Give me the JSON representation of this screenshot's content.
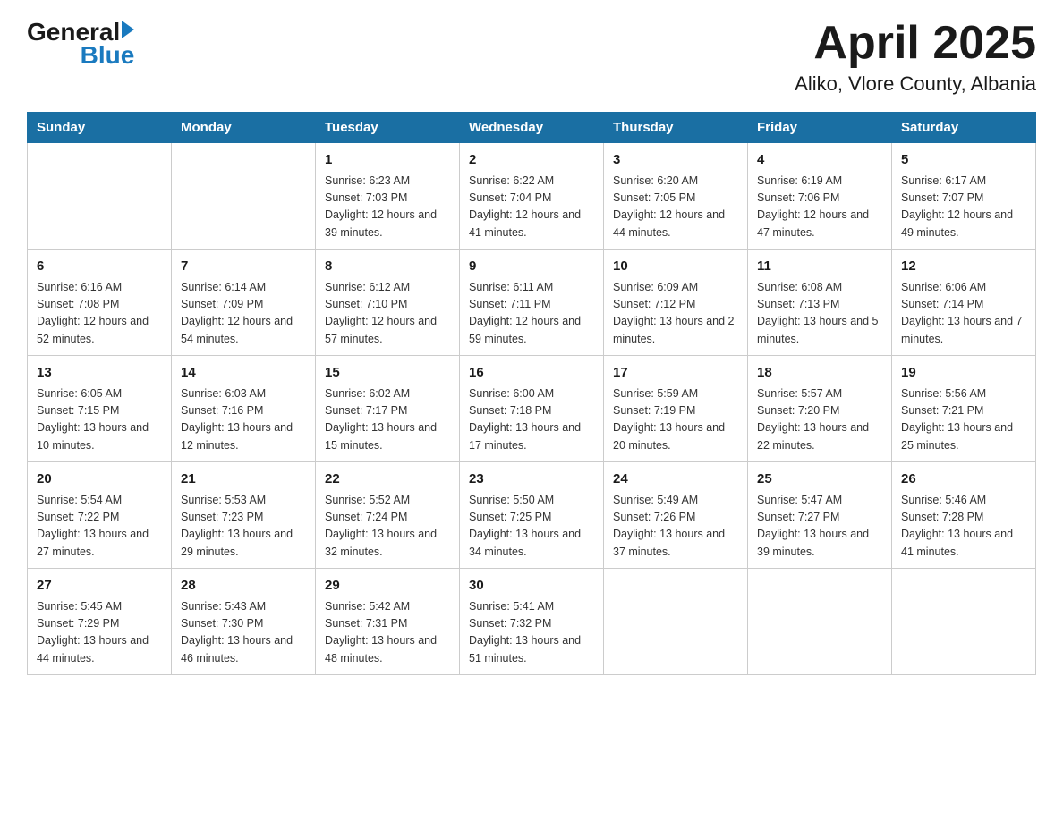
{
  "header": {
    "logo_general": "General",
    "logo_blue": "Blue",
    "month_year": "April 2025",
    "location": "Aliko, Vlore County, Albania"
  },
  "weekdays": [
    "Sunday",
    "Monday",
    "Tuesday",
    "Wednesday",
    "Thursday",
    "Friday",
    "Saturday"
  ],
  "weeks": [
    [
      {
        "day": "",
        "sunrise": "",
        "sunset": "",
        "daylight": ""
      },
      {
        "day": "",
        "sunrise": "",
        "sunset": "",
        "daylight": ""
      },
      {
        "day": "1",
        "sunrise": "Sunrise: 6:23 AM",
        "sunset": "Sunset: 7:03 PM",
        "daylight": "Daylight: 12 hours and 39 minutes."
      },
      {
        "day": "2",
        "sunrise": "Sunrise: 6:22 AM",
        "sunset": "Sunset: 7:04 PM",
        "daylight": "Daylight: 12 hours and 41 minutes."
      },
      {
        "day": "3",
        "sunrise": "Sunrise: 6:20 AM",
        "sunset": "Sunset: 7:05 PM",
        "daylight": "Daylight: 12 hours and 44 minutes."
      },
      {
        "day": "4",
        "sunrise": "Sunrise: 6:19 AM",
        "sunset": "Sunset: 7:06 PM",
        "daylight": "Daylight: 12 hours and 47 minutes."
      },
      {
        "day": "5",
        "sunrise": "Sunrise: 6:17 AM",
        "sunset": "Sunset: 7:07 PM",
        "daylight": "Daylight: 12 hours and 49 minutes."
      }
    ],
    [
      {
        "day": "6",
        "sunrise": "Sunrise: 6:16 AM",
        "sunset": "Sunset: 7:08 PM",
        "daylight": "Daylight: 12 hours and 52 minutes."
      },
      {
        "day": "7",
        "sunrise": "Sunrise: 6:14 AM",
        "sunset": "Sunset: 7:09 PM",
        "daylight": "Daylight: 12 hours and 54 minutes."
      },
      {
        "day": "8",
        "sunrise": "Sunrise: 6:12 AM",
        "sunset": "Sunset: 7:10 PM",
        "daylight": "Daylight: 12 hours and 57 minutes."
      },
      {
        "day": "9",
        "sunrise": "Sunrise: 6:11 AM",
        "sunset": "Sunset: 7:11 PM",
        "daylight": "Daylight: 12 hours and 59 minutes."
      },
      {
        "day": "10",
        "sunrise": "Sunrise: 6:09 AM",
        "sunset": "Sunset: 7:12 PM",
        "daylight": "Daylight: 13 hours and 2 minutes."
      },
      {
        "day": "11",
        "sunrise": "Sunrise: 6:08 AM",
        "sunset": "Sunset: 7:13 PM",
        "daylight": "Daylight: 13 hours and 5 minutes."
      },
      {
        "day": "12",
        "sunrise": "Sunrise: 6:06 AM",
        "sunset": "Sunset: 7:14 PM",
        "daylight": "Daylight: 13 hours and 7 minutes."
      }
    ],
    [
      {
        "day": "13",
        "sunrise": "Sunrise: 6:05 AM",
        "sunset": "Sunset: 7:15 PM",
        "daylight": "Daylight: 13 hours and 10 minutes."
      },
      {
        "day": "14",
        "sunrise": "Sunrise: 6:03 AM",
        "sunset": "Sunset: 7:16 PM",
        "daylight": "Daylight: 13 hours and 12 minutes."
      },
      {
        "day": "15",
        "sunrise": "Sunrise: 6:02 AM",
        "sunset": "Sunset: 7:17 PM",
        "daylight": "Daylight: 13 hours and 15 minutes."
      },
      {
        "day": "16",
        "sunrise": "Sunrise: 6:00 AM",
        "sunset": "Sunset: 7:18 PM",
        "daylight": "Daylight: 13 hours and 17 minutes."
      },
      {
        "day": "17",
        "sunrise": "Sunrise: 5:59 AM",
        "sunset": "Sunset: 7:19 PM",
        "daylight": "Daylight: 13 hours and 20 minutes."
      },
      {
        "day": "18",
        "sunrise": "Sunrise: 5:57 AM",
        "sunset": "Sunset: 7:20 PM",
        "daylight": "Daylight: 13 hours and 22 minutes."
      },
      {
        "day": "19",
        "sunrise": "Sunrise: 5:56 AM",
        "sunset": "Sunset: 7:21 PM",
        "daylight": "Daylight: 13 hours and 25 minutes."
      }
    ],
    [
      {
        "day": "20",
        "sunrise": "Sunrise: 5:54 AM",
        "sunset": "Sunset: 7:22 PM",
        "daylight": "Daylight: 13 hours and 27 minutes."
      },
      {
        "day": "21",
        "sunrise": "Sunrise: 5:53 AM",
        "sunset": "Sunset: 7:23 PM",
        "daylight": "Daylight: 13 hours and 29 minutes."
      },
      {
        "day": "22",
        "sunrise": "Sunrise: 5:52 AM",
        "sunset": "Sunset: 7:24 PM",
        "daylight": "Daylight: 13 hours and 32 minutes."
      },
      {
        "day": "23",
        "sunrise": "Sunrise: 5:50 AM",
        "sunset": "Sunset: 7:25 PM",
        "daylight": "Daylight: 13 hours and 34 minutes."
      },
      {
        "day": "24",
        "sunrise": "Sunrise: 5:49 AM",
        "sunset": "Sunset: 7:26 PM",
        "daylight": "Daylight: 13 hours and 37 minutes."
      },
      {
        "day": "25",
        "sunrise": "Sunrise: 5:47 AM",
        "sunset": "Sunset: 7:27 PM",
        "daylight": "Daylight: 13 hours and 39 minutes."
      },
      {
        "day": "26",
        "sunrise": "Sunrise: 5:46 AM",
        "sunset": "Sunset: 7:28 PM",
        "daylight": "Daylight: 13 hours and 41 minutes."
      }
    ],
    [
      {
        "day": "27",
        "sunrise": "Sunrise: 5:45 AM",
        "sunset": "Sunset: 7:29 PM",
        "daylight": "Daylight: 13 hours and 44 minutes."
      },
      {
        "day": "28",
        "sunrise": "Sunrise: 5:43 AM",
        "sunset": "Sunset: 7:30 PM",
        "daylight": "Daylight: 13 hours and 46 minutes."
      },
      {
        "day": "29",
        "sunrise": "Sunrise: 5:42 AM",
        "sunset": "Sunset: 7:31 PM",
        "daylight": "Daylight: 13 hours and 48 minutes."
      },
      {
        "day": "30",
        "sunrise": "Sunrise: 5:41 AM",
        "sunset": "Sunset: 7:32 PM",
        "daylight": "Daylight: 13 hours and 51 minutes."
      },
      {
        "day": "",
        "sunrise": "",
        "sunset": "",
        "daylight": ""
      },
      {
        "day": "",
        "sunrise": "",
        "sunset": "",
        "daylight": ""
      },
      {
        "day": "",
        "sunrise": "",
        "sunset": "",
        "daylight": ""
      }
    ]
  ]
}
